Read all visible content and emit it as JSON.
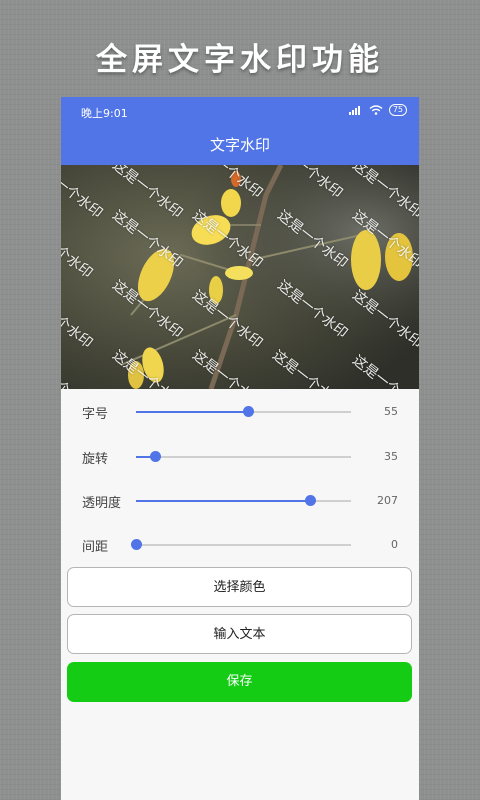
{
  "promo": {
    "title": "全屏文字水印功能"
  },
  "status_bar": {
    "time": "晚上9:01",
    "battery": "75"
  },
  "app_bar": {
    "title": "文字水印"
  },
  "image": {
    "watermark_text": "这是一个水印",
    "watermark_color": "#ffffff"
  },
  "sliders": [
    {
      "label": "字号",
      "value": "55",
      "fraction": 0.52
    },
    {
      "label": "旋转",
      "value": "35",
      "fraction": 0.09
    },
    {
      "label": "透明度",
      "value": "207",
      "fraction": 0.81
    },
    {
      "label": "间距",
      "value": "0",
      "fraction": 0.0
    }
  ],
  "buttons": {
    "choose_color": "选择颜色",
    "input_text": "输入文本",
    "save": "保存"
  },
  "colors": {
    "accent": "#5175e6",
    "save_button": "#14cc14"
  }
}
